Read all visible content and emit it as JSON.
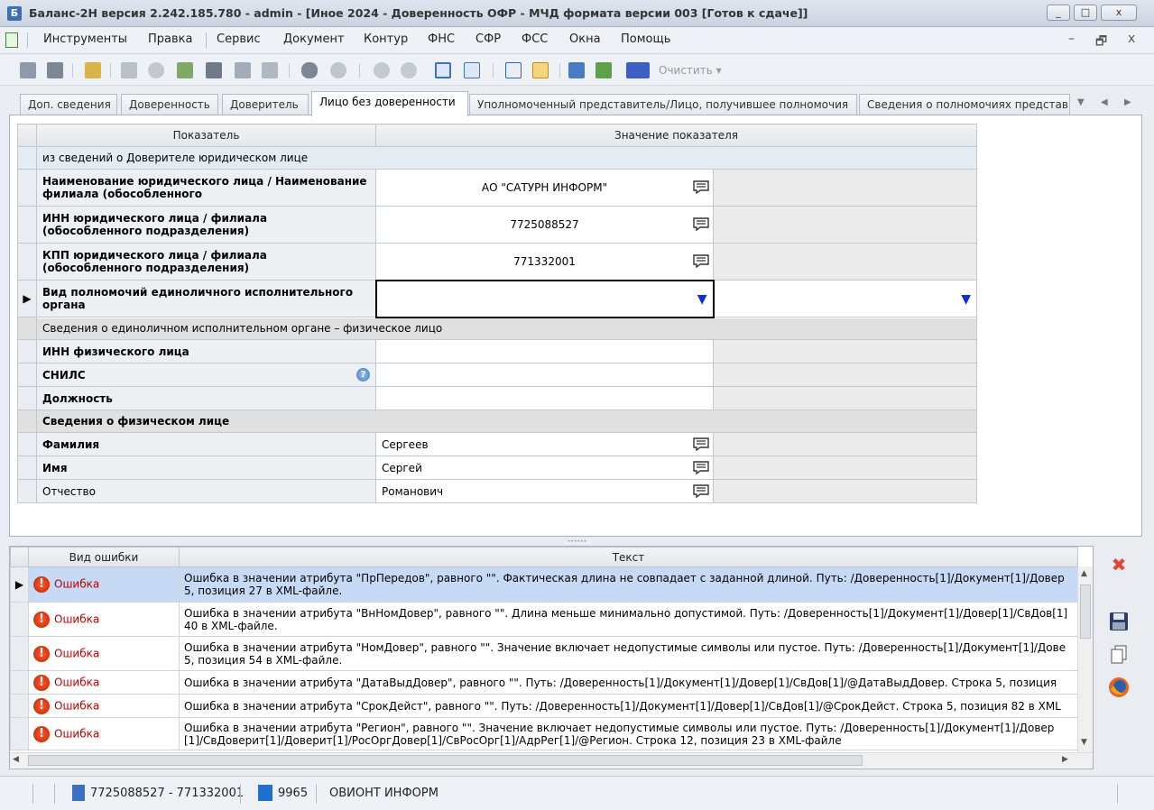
{
  "window": {
    "title": "Баланс-2Н версия 2.242.185.780 - admin - [Иное 2024 -  Доверенность ОФР - МЧД формата версии 003 [Готов к сдаче]]",
    "controls": [
      "_",
      "□",
      "x"
    ]
  },
  "menu": {
    "items": [
      "Инструменты",
      "Правка",
      "Сервис",
      "Документ",
      "Контур",
      "ФНС",
      "СФР",
      "ФСС",
      "Окна",
      "Помощь"
    ],
    "mdi_controls": [
      "–",
      "🗗",
      "x"
    ]
  },
  "toolbar": {
    "clear_label": "Очистить ▾"
  },
  "tabs": [
    "Доп. сведения",
    "Доверенность",
    "Доверитель",
    "Лицо без доверенности",
    "Уполномоченный представитель/Лицо, получившее полномочия",
    "Сведения о полномочиях представ"
  ],
  "active_tab": 3,
  "tab_nav": [
    "▼",
    "◀",
    "▶"
  ],
  "grid": {
    "headers": [
      "Показатель",
      "Значение показателя"
    ],
    "section1": "из сведений о Доверителе юридическом лице",
    "rows_top": [
      {
        "label": "Наименование юридического лица / Наименование филиала (обособленного",
        "value": "АО \"САТУРН ИНФОРМ\""
      },
      {
        "label": "ИНН юридического лица / филиала (обособленного подразделения)",
        "value": "7725088527"
      },
      {
        "label": "КПП юридического лица / филиала (обособленного подразделения)",
        "value": "771332001"
      }
    ],
    "selected_row_label": "Вид полномочий единоличного исполнительного органа",
    "section2": "Сведения о единоличном исполнительном органе – физическое лицо",
    "inn_fl": "ИНН физического лица",
    "snils": "СНИЛС",
    "position": "Должность",
    "fl_section": "Сведения о физическом лице",
    "surname": {
      "label": "Фамилия",
      "value": "Сергеев"
    },
    "name": {
      "label": "Имя",
      "value": "Сергей"
    },
    "patronymic": {
      "label": "Отчество",
      "value": "Романович"
    }
  },
  "errors": {
    "headers": [
      "Вид ошибки",
      "Текст"
    ],
    "type_label": "Ошибка",
    "rows": [
      "Ошибка в значении атрибута \"ПрПередов\", равного \"\". Фактическая длина не совпадает с заданной длиной. Путь: /Доверенность[1]/Документ[1]/Довер 5, позиция 27 в XML-файле.",
      "Ошибка в значении атрибута \"ВнНомДовер\", равного \"\". Длина меньше минимально допустимой. Путь: /Доверенность[1]/Документ[1]/Довер[1]/СвДов[1] 40 в XML-файле.",
      "Ошибка в значении атрибута \"НомДовер\", равного \"\". Значение включает недопустимые символы или пустое. Путь: /Доверенность[1]/Документ[1]/Дове 5, позиция 54 в XML-файле.",
      "Ошибка в значении атрибута \"ДатаВыдДовер\", равного \"\". Путь: /Доверенность[1]/Документ[1]/Довер[1]/СвДов[1]/@ДатаВыдДовер. Строка 5, позиция",
      "Ошибка в значении атрибута \"СрокДейст\", равного \"\". Путь: /Доверенность[1]/Документ[1]/Довер[1]/СвДов[1]/@СрокДейст. Строка 5, позиция 82 в XML",
      "Ошибка в значении атрибута \"Регион\", равного \"\". Значение включает недопустимые символы или пустое. Путь: /Доверенность[1]/Документ[1]/Довер[1]/СвДоверит[1]/Доверит[1]/РосОргДовер[1]/СвРосОрг[1]/АдрРег[1]/@Регион. Строка 12, позиция 23 в XML-файле"
    ]
  },
  "status": {
    "org_ids": "7725088527 - 771332001",
    "code": "9965",
    "org_name": "ОВИОНТ ИНФОРМ"
  }
}
